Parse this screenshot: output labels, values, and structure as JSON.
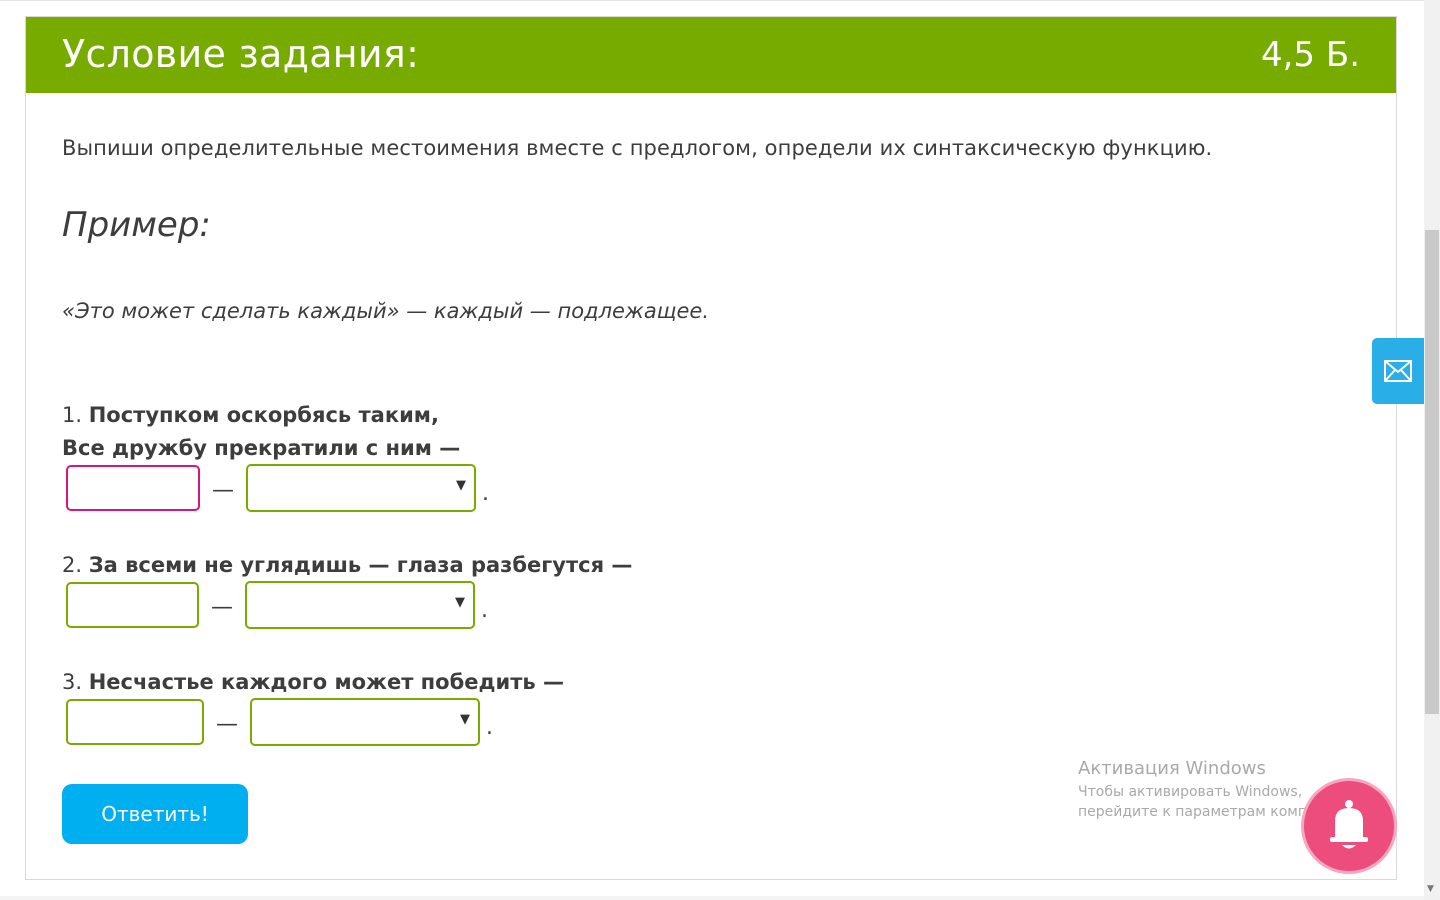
{
  "header": {
    "title": "Условие задания:",
    "points": "4,5 Б."
  },
  "instruction": "Выпиши определительные местоимения вместе с предлогом, определи их синтаксическую функцию.",
  "example": {
    "heading": "Пример:",
    "text": "«Это может сделать каждый» — каждый — подлежащее."
  },
  "questions": [
    {
      "number": "1.",
      "line1": "Поступком оскорбясь таким,",
      "line2": "Все дружбу прекратили с ним —",
      "input_value": "",
      "select_value": ""
    },
    {
      "number": "2.",
      "line1": "За всеми не углядишь — глаза разбегутся —",
      "input_value": "",
      "select_value": ""
    },
    {
      "number": "3.",
      "line1": "Несчастье каждого может победить —",
      "input_value": "",
      "select_value": ""
    }
  ],
  "separator": "—",
  "period": ".",
  "submit_label": "Ответить!",
  "watermark": {
    "title": "Активация Windows",
    "subtitle": "Чтобы активировать Windows, перейдите к параметрам компьютера."
  },
  "icons": {
    "mail": "envelope-icon",
    "bell": "bell-icon"
  },
  "colors": {
    "header_bg": "#77ab00",
    "input_border": "#77ab00",
    "focused_border": "#d8157c",
    "button_bg": "#00aff0",
    "mail_tab_bg": "#29aee8",
    "bell_bg": "#ec4d7d"
  }
}
